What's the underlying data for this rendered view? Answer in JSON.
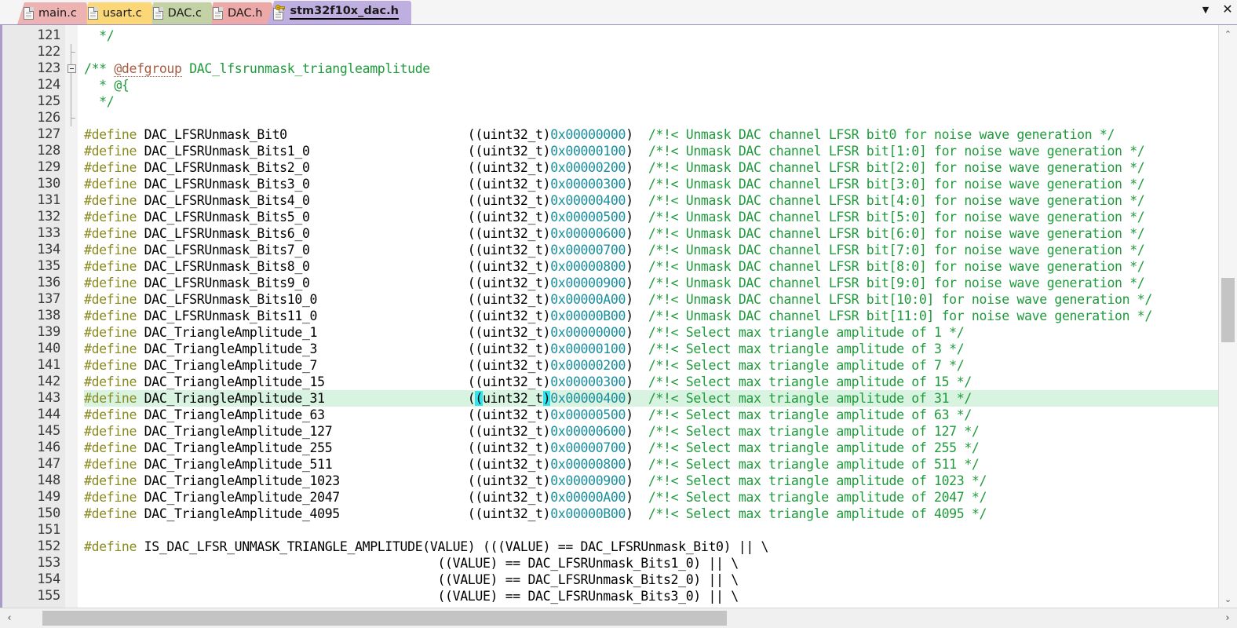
{
  "window": {
    "tabbar_controls": {
      "dropdown_label": "▼",
      "dropdown_name": "tab-list-dropdown",
      "close_label": "✕",
      "close_name": "close-document"
    }
  },
  "tabs": [
    {
      "label": "main.c",
      "color": "#edb2b2",
      "theme": "pink",
      "active": false,
      "icon": "document-icon"
    },
    {
      "label": "usart.c",
      "color": "#fcd778",
      "theme": "yellow",
      "active": false,
      "icon": "document-icon"
    },
    {
      "label": "DAC.c",
      "color": "#c3d2a4",
      "theme": "green",
      "active": false,
      "icon": "document-icon"
    },
    {
      "label": "DAC.h",
      "color": "#eda8a8",
      "theme": "salmon",
      "active": false,
      "icon": "document-icon"
    },
    {
      "label": "stm32f10x_dac.h",
      "color": "#bfaee0",
      "theme": "purple",
      "active": true,
      "icon": "document-readonly-key-icon"
    }
  ],
  "editor": {
    "highlight_color": "#d8f3df",
    "bracket_match_color": "#2fe3ef",
    "syntax_colors": {
      "preprocessor": "#8a8a1f",
      "identifier": "#000000",
      "comment": "#1f9b3c",
      "doc_keyword": "#a55c42",
      "number": "#1a8fa0"
    },
    "first_line": 121,
    "lines": [
      {
        "n": 121,
        "fold": "tick-none",
        "tokens": [
          {
            "t": "  ",
            "c": "t-id"
          },
          {
            "t": "*/",
            "c": "t-cmt"
          }
        ]
      },
      {
        "n": 122,
        "fold": "tick",
        "tokens": []
      },
      {
        "n": 123,
        "fold": "box-minus",
        "tokens": [
          {
            "t": "/** ",
            "c": "t-cmt"
          },
          {
            "t": "@defgroup",
            "c": "t-doc"
          },
          {
            "t": " DAC_lfsrunmask_triangleamplitude",
            "c": "t-cmt"
          }
        ]
      },
      {
        "n": 124,
        "fold": "line",
        "tokens": [
          {
            "t": "  * @{",
            "c": "t-cmt"
          }
        ]
      },
      {
        "n": 125,
        "fold": "line",
        "tokens": [
          {
            "t": "  */",
            "c": "t-cmt"
          }
        ]
      },
      {
        "n": 126,
        "fold": "tick",
        "tokens": []
      },
      {
        "n": 127,
        "fold": "none",
        "tokens": [
          {
            "t": "#define",
            "c": "t-pre"
          },
          {
            "t": " DAC_LFSRUnmask_Bit0                        ((uint32_t)",
            "c": "t-id"
          },
          {
            "t": "0x00000000",
            "c": "t-num"
          },
          {
            "t": ")  ",
            "c": "t-id"
          },
          {
            "t": "/*!< Unmask DAC channel LFSR bit0 for noise wave generation */",
            "c": "t-cmt"
          }
        ]
      },
      {
        "n": 128,
        "fold": "none",
        "tokens": [
          {
            "t": "#define",
            "c": "t-pre"
          },
          {
            "t": " DAC_LFSRUnmask_Bits1_0                     ((uint32_t)",
            "c": "t-id"
          },
          {
            "t": "0x00000100",
            "c": "t-num"
          },
          {
            "t": ")  ",
            "c": "t-id"
          },
          {
            "t": "/*!< Unmask DAC channel LFSR bit[1:0] for noise wave generation */",
            "c": "t-cmt"
          }
        ]
      },
      {
        "n": 129,
        "fold": "none",
        "tokens": [
          {
            "t": "#define",
            "c": "t-pre"
          },
          {
            "t": " DAC_LFSRUnmask_Bits2_0                     ((uint32_t)",
            "c": "t-id"
          },
          {
            "t": "0x00000200",
            "c": "t-num"
          },
          {
            "t": ")  ",
            "c": "t-id"
          },
          {
            "t": "/*!< Unmask DAC channel LFSR bit[2:0] for noise wave generation */",
            "c": "t-cmt"
          }
        ]
      },
      {
        "n": 130,
        "fold": "none",
        "tokens": [
          {
            "t": "#define",
            "c": "t-pre"
          },
          {
            "t": " DAC_LFSRUnmask_Bits3_0                     ((uint32_t)",
            "c": "t-id"
          },
          {
            "t": "0x00000300",
            "c": "t-num"
          },
          {
            "t": ")  ",
            "c": "t-id"
          },
          {
            "t": "/*!< Unmask DAC channel LFSR bit[3:0] for noise wave generation */",
            "c": "t-cmt"
          }
        ]
      },
      {
        "n": 131,
        "fold": "none",
        "tokens": [
          {
            "t": "#define",
            "c": "t-pre"
          },
          {
            "t": " DAC_LFSRUnmask_Bits4_0                     ((uint32_t)",
            "c": "t-id"
          },
          {
            "t": "0x00000400",
            "c": "t-num"
          },
          {
            "t": ")  ",
            "c": "t-id"
          },
          {
            "t": "/*!< Unmask DAC channel LFSR bit[4:0] for noise wave generation */",
            "c": "t-cmt"
          }
        ]
      },
      {
        "n": 132,
        "fold": "none",
        "tokens": [
          {
            "t": "#define",
            "c": "t-pre"
          },
          {
            "t": " DAC_LFSRUnmask_Bits5_0                     ((uint32_t)",
            "c": "t-id"
          },
          {
            "t": "0x00000500",
            "c": "t-num"
          },
          {
            "t": ")  ",
            "c": "t-id"
          },
          {
            "t": "/*!< Unmask DAC channel LFSR bit[5:0] for noise wave generation */",
            "c": "t-cmt"
          }
        ]
      },
      {
        "n": 133,
        "fold": "none",
        "tokens": [
          {
            "t": "#define",
            "c": "t-pre"
          },
          {
            "t": " DAC_LFSRUnmask_Bits6_0                     ((uint32_t)",
            "c": "t-id"
          },
          {
            "t": "0x00000600",
            "c": "t-num"
          },
          {
            "t": ")  ",
            "c": "t-id"
          },
          {
            "t": "/*!< Unmask DAC channel LFSR bit[6:0] for noise wave generation */",
            "c": "t-cmt"
          }
        ]
      },
      {
        "n": 134,
        "fold": "none",
        "tokens": [
          {
            "t": "#define",
            "c": "t-pre"
          },
          {
            "t": " DAC_LFSRUnmask_Bits7_0                     ((uint32_t)",
            "c": "t-id"
          },
          {
            "t": "0x00000700",
            "c": "t-num"
          },
          {
            "t": ")  ",
            "c": "t-id"
          },
          {
            "t": "/*!< Unmask DAC channel LFSR bit[7:0] for noise wave generation */",
            "c": "t-cmt"
          }
        ]
      },
      {
        "n": 135,
        "fold": "none",
        "tokens": [
          {
            "t": "#define",
            "c": "t-pre"
          },
          {
            "t": " DAC_LFSRUnmask_Bits8_0                     ((uint32_t)",
            "c": "t-id"
          },
          {
            "t": "0x00000800",
            "c": "t-num"
          },
          {
            "t": ")  ",
            "c": "t-id"
          },
          {
            "t": "/*!< Unmask DAC channel LFSR bit[8:0] for noise wave generation */",
            "c": "t-cmt"
          }
        ]
      },
      {
        "n": 136,
        "fold": "none",
        "tokens": [
          {
            "t": "#define",
            "c": "t-pre"
          },
          {
            "t": " DAC_LFSRUnmask_Bits9_0                     ((uint32_t)",
            "c": "t-id"
          },
          {
            "t": "0x00000900",
            "c": "t-num"
          },
          {
            "t": ")  ",
            "c": "t-id"
          },
          {
            "t": "/*!< Unmask DAC channel LFSR bit[9:0] for noise wave generation */",
            "c": "t-cmt"
          }
        ]
      },
      {
        "n": 137,
        "fold": "none",
        "tokens": [
          {
            "t": "#define",
            "c": "t-pre"
          },
          {
            "t": " DAC_LFSRUnmask_Bits10_0                    ((uint32_t)",
            "c": "t-id"
          },
          {
            "t": "0x00000A00",
            "c": "t-num"
          },
          {
            "t": ")  ",
            "c": "t-id"
          },
          {
            "t": "/*!< Unmask DAC channel LFSR bit[10:0] for noise wave generation */",
            "c": "t-cmt"
          }
        ]
      },
      {
        "n": 138,
        "fold": "none",
        "tokens": [
          {
            "t": "#define",
            "c": "t-pre"
          },
          {
            "t": " DAC_LFSRUnmask_Bits11_0                    ((uint32_t)",
            "c": "t-id"
          },
          {
            "t": "0x00000B00",
            "c": "t-num"
          },
          {
            "t": ")  ",
            "c": "t-id"
          },
          {
            "t": "/*!< Unmask DAC channel LFSR bit[11:0] for noise wave generation */",
            "c": "t-cmt"
          }
        ]
      },
      {
        "n": 139,
        "fold": "none",
        "tokens": [
          {
            "t": "#define",
            "c": "t-pre"
          },
          {
            "t": " DAC_TriangleAmplitude_1                    ((uint32_t)",
            "c": "t-id"
          },
          {
            "t": "0x00000000",
            "c": "t-num"
          },
          {
            "t": ")  ",
            "c": "t-id"
          },
          {
            "t": "/*!< Select max triangle amplitude of 1 */",
            "c": "t-cmt"
          }
        ]
      },
      {
        "n": 140,
        "fold": "none",
        "tokens": [
          {
            "t": "#define",
            "c": "t-pre"
          },
          {
            "t": " DAC_TriangleAmplitude_3                    ((uint32_t)",
            "c": "t-id"
          },
          {
            "t": "0x00000100",
            "c": "t-num"
          },
          {
            "t": ")  ",
            "c": "t-id"
          },
          {
            "t": "/*!< Select max triangle amplitude of 3 */",
            "c": "t-cmt"
          }
        ]
      },
      {
        "n": 141,
        "fold": "none",
        "tokens": [
          {
            "t": "#define",
            "c": "t-pre"
          },
          {
            "t": " DAC_TriangleAmplitude_7                    ((uint32_t)",
            "c": "t-id"
          },
          {
            "t": "0x00000200",
            "c": "t-num"
          },
          {
            "t": ")  ",
            "c": "t-id"
          },
          {
            "t": "/*!< Select max triangle amplitude of 7 */",
            "c": "t-cmt"
          }
        ]
      },
      {
        "n": 142,
        "fold": "none",
        "tokens": [
          {
            "t": "#define",
            "c": "t-pre"
          },
          {
            "t": " DAC_TriangleAmplitude_15                   ((uint32_t)",
            "c": "t-id"
          },
          {
            "t": "0x00000300",
            "c": "t-num"
          },
          {
            "t": ")  ",
            "c": "t-id"
          },
          {
            "t": "/*!< Select max triangle amplitude of 15 */",
            "c": "t-cmt"
          }
        ]
      },
      {
        "n": 143,
        "fold": "none",
        "highlight": true,
        "tokens": [
          {
            "t": "#define",
            "c": "t-pre"
          },
          {
            "t": " DAC_TriangleAmplitude_31                   (",
            "c": "t-id"
          },
          {
            "t": "(",
            "c": "t-brk"
          },
          {
            "t": "uint32_t",
            "c": "t-id"
          },
          {
            "t": ")",
            "c": "t-brk"
          },
          {
            "t": "0x00000400",
            "c": "t-num"
          },
          {
            "t": ")  ",
            "c": "t-id"
          },
          {
            "t": "/*!< Select max triangle amplitude of 31 */",
            "c": "t-cmt"
          }
        ]
      },
      {
        "n": 144,
        "fold": "none",
        "tokens": [
          {
            "t": "#define",
            "c": "t-pre"
          },
          {
            "t": " DAC_TriangleAmplitude_63                   ((uint32_t)",
            "c": "t-id"
          },
          {
            "t": "0x00000500",
            "c": "t-num"
          },
          {
            "t": ")  ",
            "c": "t-id"
          },
          {
            "t": "/*!< Select max triangle amplitude of 63 */",
            "c": "t-cmt"
          }
        ]
      },
      {
        "n": 145,
        "fold": "none",
        "tokens": [
          {
            "t": "#define",
            "c": "t-pre"
          },
          {
            "t": " DAC_TriangleAmplitude_127                  ((uint32_t)",
            "c": "t-id"
          },
          {
            "t": "0x00000600",
            "c": "t-num"
          },
          {
            "t": ")  ",
            "c": "t-id"
          },
          {
            "t": "/*!< Select max triangle amplitude of 127 */",
            "c": "t-cmt"
          }
        ]
      },
      {
        "n": 146,
        "fold": "none",
        "tokens": [
          {
            "t": "#define",
            "c": "t-pre"
          },
          {
            "t": " DAC_TriangleAmplitude_255                  ((uint32_t)",
            "c": "t-id"
          },
          {
            "t": "0x00000700",
            "c": "t-num"
          },
          {
            "t": ")  ",
            "c": "t-id"
          },
          {
            "t": "/*!< Select max triangle amplitude of 255 */",
            "c": "t-cmt"
          }
        ]
      },
      {
        "n": 147,
        "fold": "none",
        "tokens": [
          {
            "t": "#define",
            "c": "t-pre"
          },
          {
            "t": " DAC_TriangleAmplitude_511                  ((uint32_t)",
            "c": "t-id"
          },
          {
            "t": "0x00000800",
            "c": "t-num"
          },
          {
            "t": ")  ",
            "c": "t-id"
          },
          {
            "t": "/*!< Select max triangle amplitude of 511 */",
            "c": "t-cmt"
          }
        ]
      },
      {
        "n": 148,
        "fold": "none",
        "tokens": [
          {
            "t": "#define",
            "c": "t-pre"
          },
          {
            "t": " DAC_TriangleAmplitude_1023                 ((uint32_t)",
            "c": "t-id"
          },
          {
            "t": "0x00000900",
            "c": "t-num"
          },
          {
            "t": ")  ",
            "c": "t-id"
          },
          {
            "t": "/*!< Select max triangle amplitude of 1023 */",
            "c": "t-cmt"
          }
        ]
      },
      {
        "n": 149,
        "fold": "none",
        "tokens": [
          {
            "t": "#define",
            "c": "t-pre"
          },
          {
            "t": " DAC_TriangleAmplitude_2047                 ((uint32_t)",
            "c": "t-id"
          },
          {
            "t": "0x00000A00",
            "c": "t-num"
          },
          {
            "t": ")  ",
            "c": "t-id"
          },
          {
            "t": "/*!< Select max triangle amplitude of 2047 */",
            "c": "t-cmt"
          }
        ]
      },
      {
        "n": 150,
        "fold": "none",
        "tokens": [
          {
            "t": "#define",
            "c": "t-pre"
          },
          {
            "t": " DAC_TriangleAmplitude_4095                 ((uint32_t)",
            "c": "t-id"
          },
          {
            "t": "0x00000B00",
            "c": "t-num"
          },
          {
            "t": ")  ",
            "c": "t-id"
          },
          {
            "t": "/*!< Select max triangle amplitude of 4095 */",
            "c": "t-cmt"
          }
        ]
      },
      {
        "n": 151,
        "fold": "none",
        "tokens": []
      },
      {
        "n": 152,
        "fold": "none",
        "tokens": [
          {
            "t": "#define",
            "c": "t-pre"
          },
          {
            "t": " IS_DAC_LFSR_UNMASK_TRIANGLE_AMPLITUDE(VALUE) (((VALUE) == DAC_LFSRUnmask_Bit0) || \\",
            "c": "t-id"
          }
        ]
      },
      {
        "n": 153,
        "fold": "none",
        "tokens": [
          {
            "t": "                                               ((VALUE) == DAC_LFSRUnmask_Bits1_0) || \\",
            "c": "t-id"
          }
        ]
      },
      {
        "n": 154,
        "fold": "none",
        "tokens": [
          {
            "t": "                                               ((VALUE) == DAC_LFSRUnmask_Bits2_0) || \\",
            "c": "t-id"
          }
        ]
      },
      {
        "n": 155,
        "fold": "none",
        "tokens": [
          {
            "t": "                                               ((VALUE) == DAC_LFSRUnmask_Bits3_0) || \\",
            "c": "t-id"
          }
        ]
      }
    ]
  },
  "scrollbars": {
    "vertical": {
      "up_arrow": "⌃",
      "down_arrow": "⌄"
    },
    "horizontal": {
      "left_arrow": "‹",
      "right_arrow": "›"
    }
  }
}
